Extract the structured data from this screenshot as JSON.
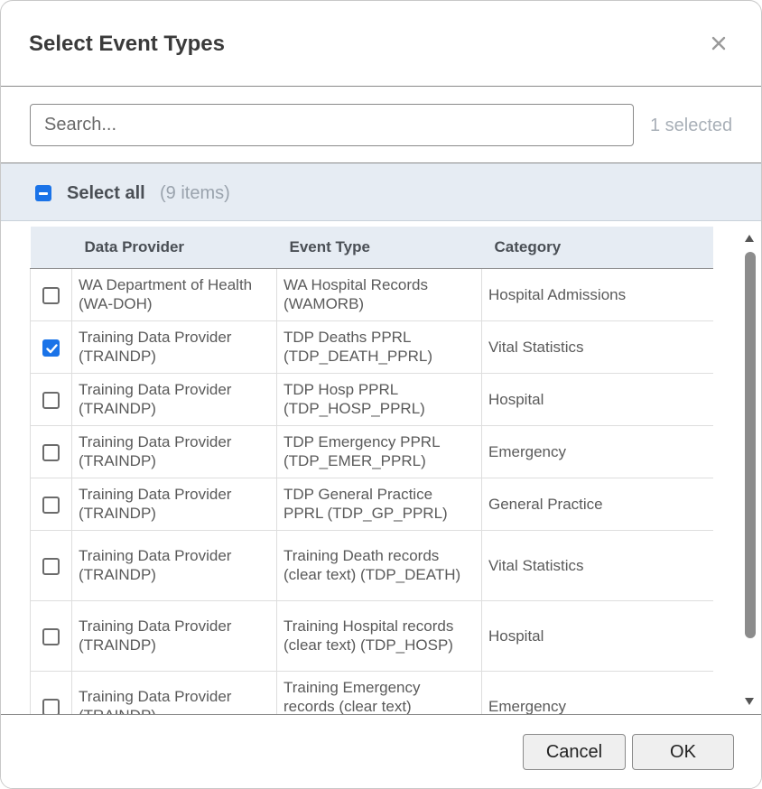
{
  "dialog": {
    "title": "Select Event Types",
    "close_icon": "close-icon"
  },
  "search": {
    "placeholder": "Search...",
    "value": ""
  },
  "selection": {
    "count_text": "1 selected"
  },
  "select_all": {
    "label": "Select all",
    "count_text": "(9 items)",
    "state": "indeterminate"
  },
  "table": {
    "headers": {
      "provider": "Data Provider",
      "event_type": "Event Type",
      "category": "Category"
    },
    "rows": [
      {
        "checked": false,
        "provider": "WA Department of Health (WA-DOH)",
        "event_type": "WA Hospital Records (WAMORB)",
        "category": "Hospital Admissions"
      },
      {
        "checked": true,
        "provider": "Training Data Provider (TRAINDP)",
        "event_type": "TDP Deaths PPRL (TDP_DEATH_PPRL)",
        "category": "Vital Statistics"
      },
      {
        "checked": false,
        "provider": "Training Data Provider (TRAINDP)",
        "event_type": "TDP Hosp PPRL (TDP_HOSP_PPRL)",
        "category": "Hospital"
      },
      {
        "checked": false,
        "provider": "Training Data Provider (TRAINDP)",
        "event_type": "TDP Emergency PPRL (TDP_EMER_PPRL)",
        "category": "Emergency"
      },
      {
        "checked": false,
        "provider": "Training Data Provider (TRAINDP)",
        "event_type": "TDP General Practice PPRL (TDP_GP_PPRL)",
        "category": "General Practice"
      },
      {
        "checked": false,
        "provider": "Training Data Provider (TRAINDP)",
        "event_type": "Training Death records (clear text) (TDP_DEATH)",
        "category": "Vital Statistics"
      },
      {
        "checked": false,
        "provider": "Training Data Provider (TRAINDP)",
        "event_type": "Training Hospital records (clear text) (TDP_HOSP)",
        "category": "Hospital"
      },
      {
        "checked": false,
        "provider": "Training Data Provider (TRAINDP)",
        "event_type": "Training Emergency records (clear text) (TDP_EMER)",
        "category": "Emergency"
      }
    ]
  },
  "footer": {
    "cancel_label": "Cancel",
    "ok_label": "OK"
  },
  "colors": {
    "accent": "#1a73e8",
    "header_band": "#e6ecf3",
    "muted_text": "#a9b0b8"
  }
}
